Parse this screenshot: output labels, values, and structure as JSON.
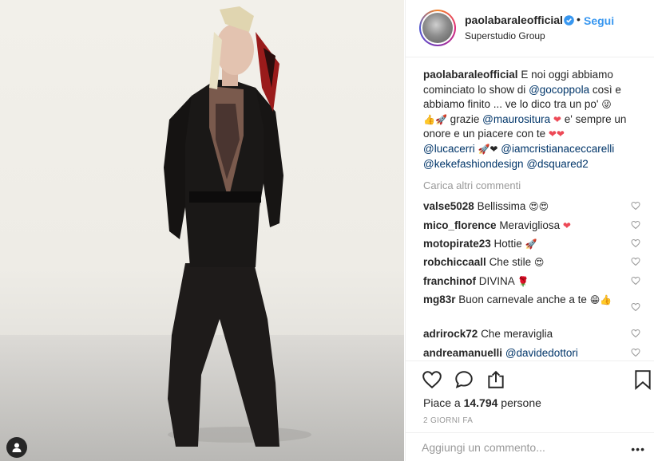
{
  "header": {
    "username": "paolabaraleofficial",
    "follow_label": "Segui",
    "dot": "•",
    "location": "Superstudio Group"
  },
  "caption": {
    "username": "paolabaraleofficial",
    "t1": "E noi oggi abbiamo cominciato lo show di ",
    "m1": "@gocoppola",
    "t2": " così e abbiamo finito ... ve lo dico tra un po' ",
    "e1": "😜",
    "e2": "👍🚀",
    "t3": " grazie ",
    "m2": "@maurositura",
    "e3": "❤",
    "t4": " e' sempre un onore e un piacere con te ",
    "e4": "❤❤",
    "m3": "@lucacerri",
    "e5": "🚀❤",
    "m4": "@iamcristianaceccarelli",
    "m5": "@kekefashiondesign",
    "m6": "@dsquared2"
  },
  "load_more": "Carica altri commenti",
  "comments": [
    {
      "user": "valse5028",
      "text": "Bellissima",
      "emoji": "😍😍"
    },
    {
      "user": "mico_florence",
      "text": "Meravigliosa",
      "emoji": "❤"
    },
    {
      "user": "motopirate23",
      "text": "Hottie",
      "emoji": "🚀"
    },
    {
      "user": "robchiccaall",
      "text": "Che stile",
      "emoji": "😍"
    },
    {
      "user": "franchinof",
      "text": "DIVINA",
      "emoji": "🌹"
    },
    {
      "user": "mg83r",
      "text": "Buon carnevale anche a te",
      "emoji": "😁👍"
    },
    {
      "user": "adrirock72",
      "text": "Che meraviglia",
      "emoji": ""
    },
    {
      "user": "andreamanuelli",
      "text": "",
      "mention": "@davidedottori",
      "emoji": ""
    }
  ],
  "likes": {
    "prefix": "Piace a ",
    "count": "14.794",
    "suffix": " persone"
  },
  "time_ago": "2 GIORNI FA",
  "add_comment": {
    "placeholder": "Aggiungi un commento..."
  },
  "more": "•••",
  "colors": {
    "link": "#3897f0",
    "mention": "#003569",
    "muted": "#999999",
    "heart_red": "#ed4956"
  }
}
